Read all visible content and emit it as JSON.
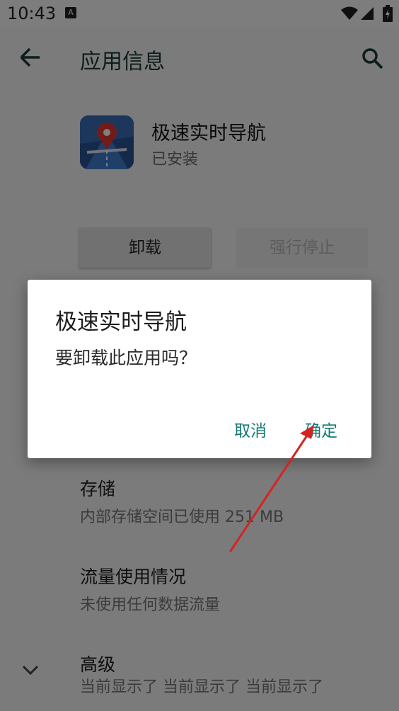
{
  "status_bar": {
    "time": "10:43",
    "notification_icon": "A"
  },
  "toolbar": {
    "title": "应用信息"
  },
  "app": {
    "name": "极速实时导航",
    "status": "已安装"
  },
  "buttons": {
    "uninstall": "卸载",
    "force_stop": "强行停止"
  },
  "settings": [
    {
      "title": "存储",
      "subtitle": "内部存储空间已使用 251 MB"
    },
    {
      "title": "流量使用情况",
      "subtitle": "未使用任何数据流量"
    },
    {
      "title": "高级",
      "subtitle": "当前显示了 当前显示了 当前显示了"
    }
  ],
  "dialog": {
    "title": "极速实时导航",
    "message": "要卸载此应用吗？",
    "cancel": "取消",
    "confirm": "确定"
  },
  "colors": {
    "accent": "#137a72",
    "arrow": "#d32424"
  },
  "icons": [
    "back-arrow-icon",
    "search-icon",
    "wifi-icon",
    "signal-icon",
    "battery-icon",
    "chevron-down-icon",
    "app-map-pin-icon"
  ]
}
